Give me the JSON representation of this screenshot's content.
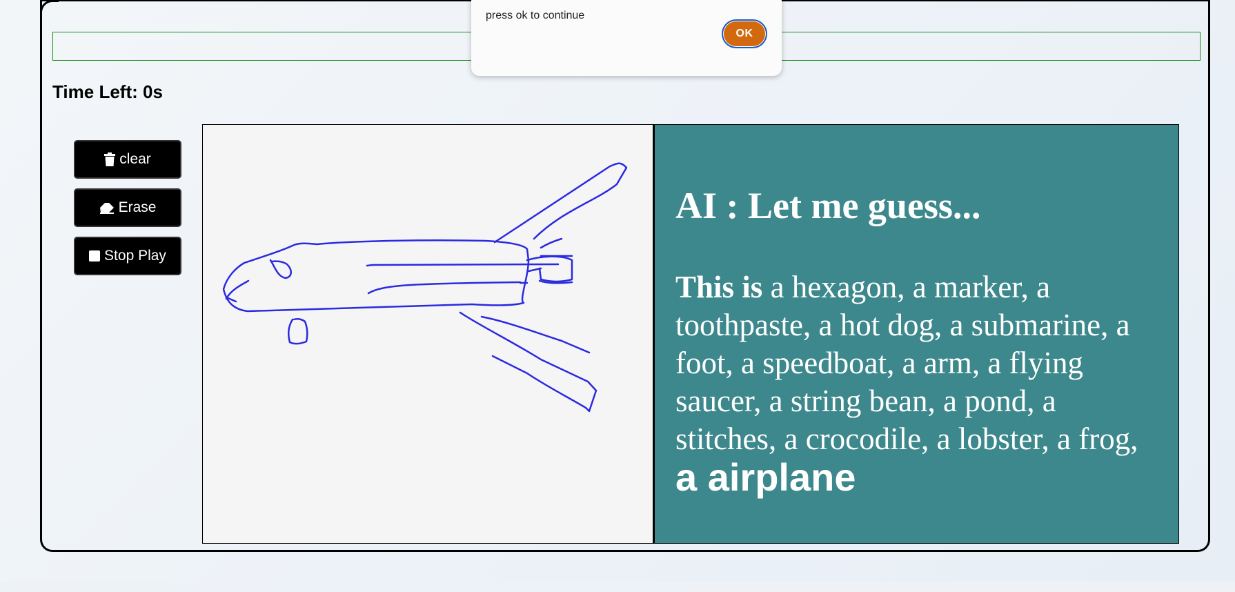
{
  "dialog": {
    "message": "press ok to continue",
    "ok_label": "OK"
  },
  "status": {
    "time_left": "Time Left: 0s"
  },
  "tools": {
    "clear_label": "clear",
    "erase_label": "Erase",
    "stop_play_label": "Stop Play"
  },
  "ai": {
    "title": "AI : Let me guess...",
    "prefix": "This is",
    "guesses": "a hexagon, a marker, a toothpaste, a hot dog, a submarine, a foot, a speedboat, a arm, a flying saucer, a string bean, a pond, a stitches, a crocodile, a lobster, a frog,",
    "final_guess": "a airplane"
  },
  "colors": {
    "ai_panel": "#3d888c",
    "ok_button": "#d3690f",
    "stroke": "#2a2ae0",
    "word_bar_border": "#1a8a1a"
  }
}
